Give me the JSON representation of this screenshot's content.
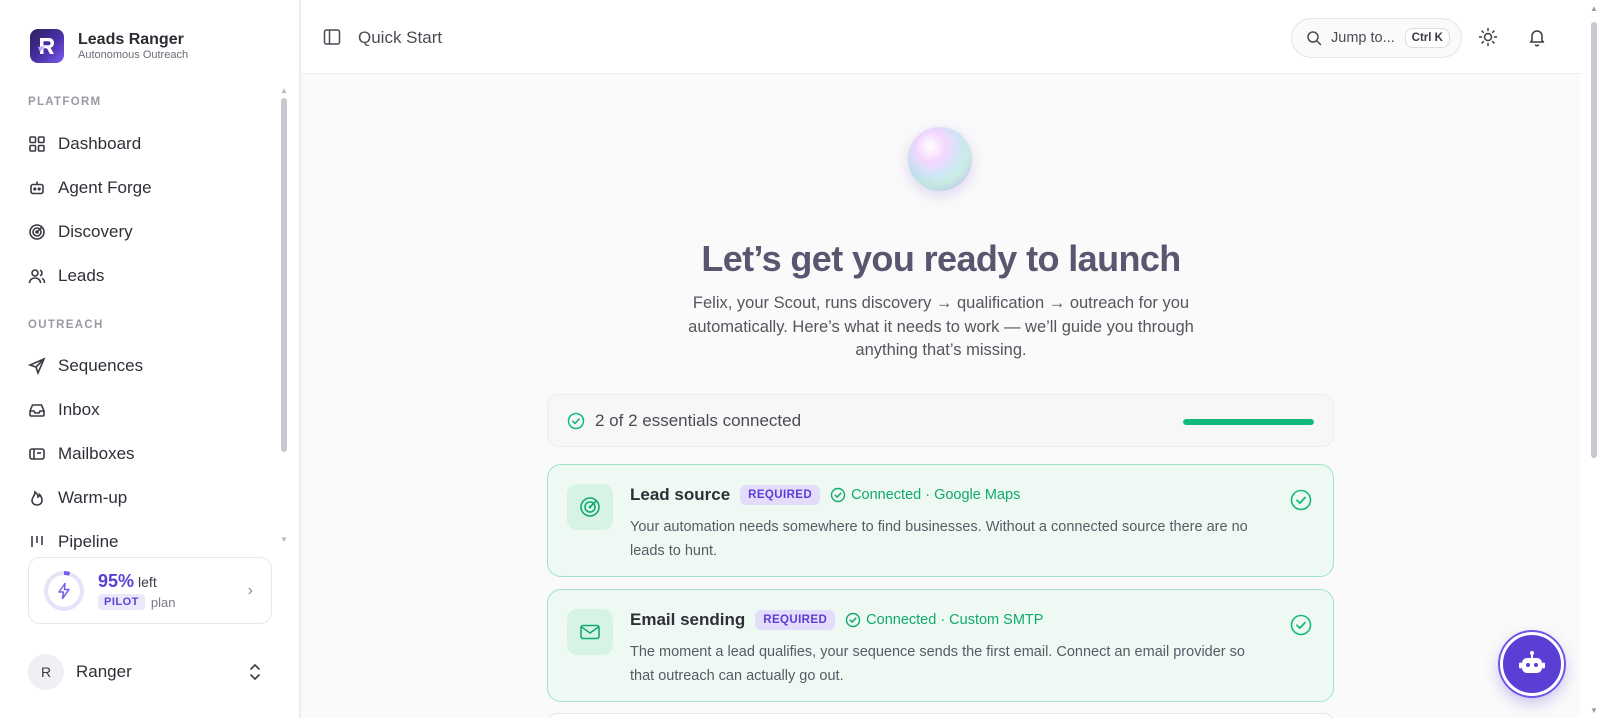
{
  "brand": {
    "name": "Leads Ranger",
    "subtitle": "Autonomous Outreach",
    "icon": "brand-logo-icon"
  },
  "sidebar": {
    "sections": [
      {
        "label": "PLATFORM",
        "items": [
          {
            "label": "Dashboard",
            "icon": "grid-icon"
          },
          {
            "label": "Agent Forge",
            "icon": "bot-icon"
          },
          {
            "label": "Discovery",
            "icon": "radar-icon"
          },
          {
            "label": "Leads",
            "icon": "users-icon"
          }
        ]
      },
      {
        "label": "OUTREACH",
        "items": [
          {
            "label": "Sequences",
            "icon": "send-icon"
          },
          {
            "label": "Inbox",
            "icon": "inbox-icon"
          },
          {
            "label": "Mailboxes",
            "icon": "mailbox-icon"
          },
          {
            "label": "Warm-up",
            "icon": "flame-icon"
          },
          {
            "label": "Pipeline",
            "icon": "pipeline-icon"
          }
        ]
      }
    ],
    "plan": {
      "percent": "95%",
      "left_label": "left",
      "badge": "PILOT",
      "plan_label": "plan",
      "remaining_fraction": 0.95
    },
    "user": {
      "initial": "R",
      "name": "Ranger"
    }
  },
  "topbar": {
    "title": "Quick Start",
    "search": {
      "label": "Jump to...",
      "shortcut": "Ctrl K"
    }
  },
  "main": {
    "headline": "Let’s get you ready to launch",
    "subcopy": "Felix, your Scout, runs discovery → qualification → outreach for you automatically. Here’s what it needs to work — we’ll guide you through anything that’s missing.",
    "progress": {
      "text": "2 of 2 essentials connected",
      "done": 2,
      "total": 2
    },
    "tasks": [
      {
        "title": "Lead source",
        "badge": "REQUIRED",
        "status": "Connected · Google Maps",
        "description": "Your automation needs somewhere to find businesses. Without a connected source there are no leads to hunt.",
        "icon": "radar-icon"
      },
      {
        "title": "Email sending",
        "badge": "REQUIRED",
        "status": "Connected · Custom SMTP",
        "description": "The moment a lead qualifies, your sequence sends the first email. Connect an email provider so that outreach can actually go out.",
        "icon": "mail-icon"
      }
    ]
  },
  "colors": {
    "accent": "#5b3fd4",
    "success": "#13b97c",
    "success_bg": "#eef9f4"
  }
}
